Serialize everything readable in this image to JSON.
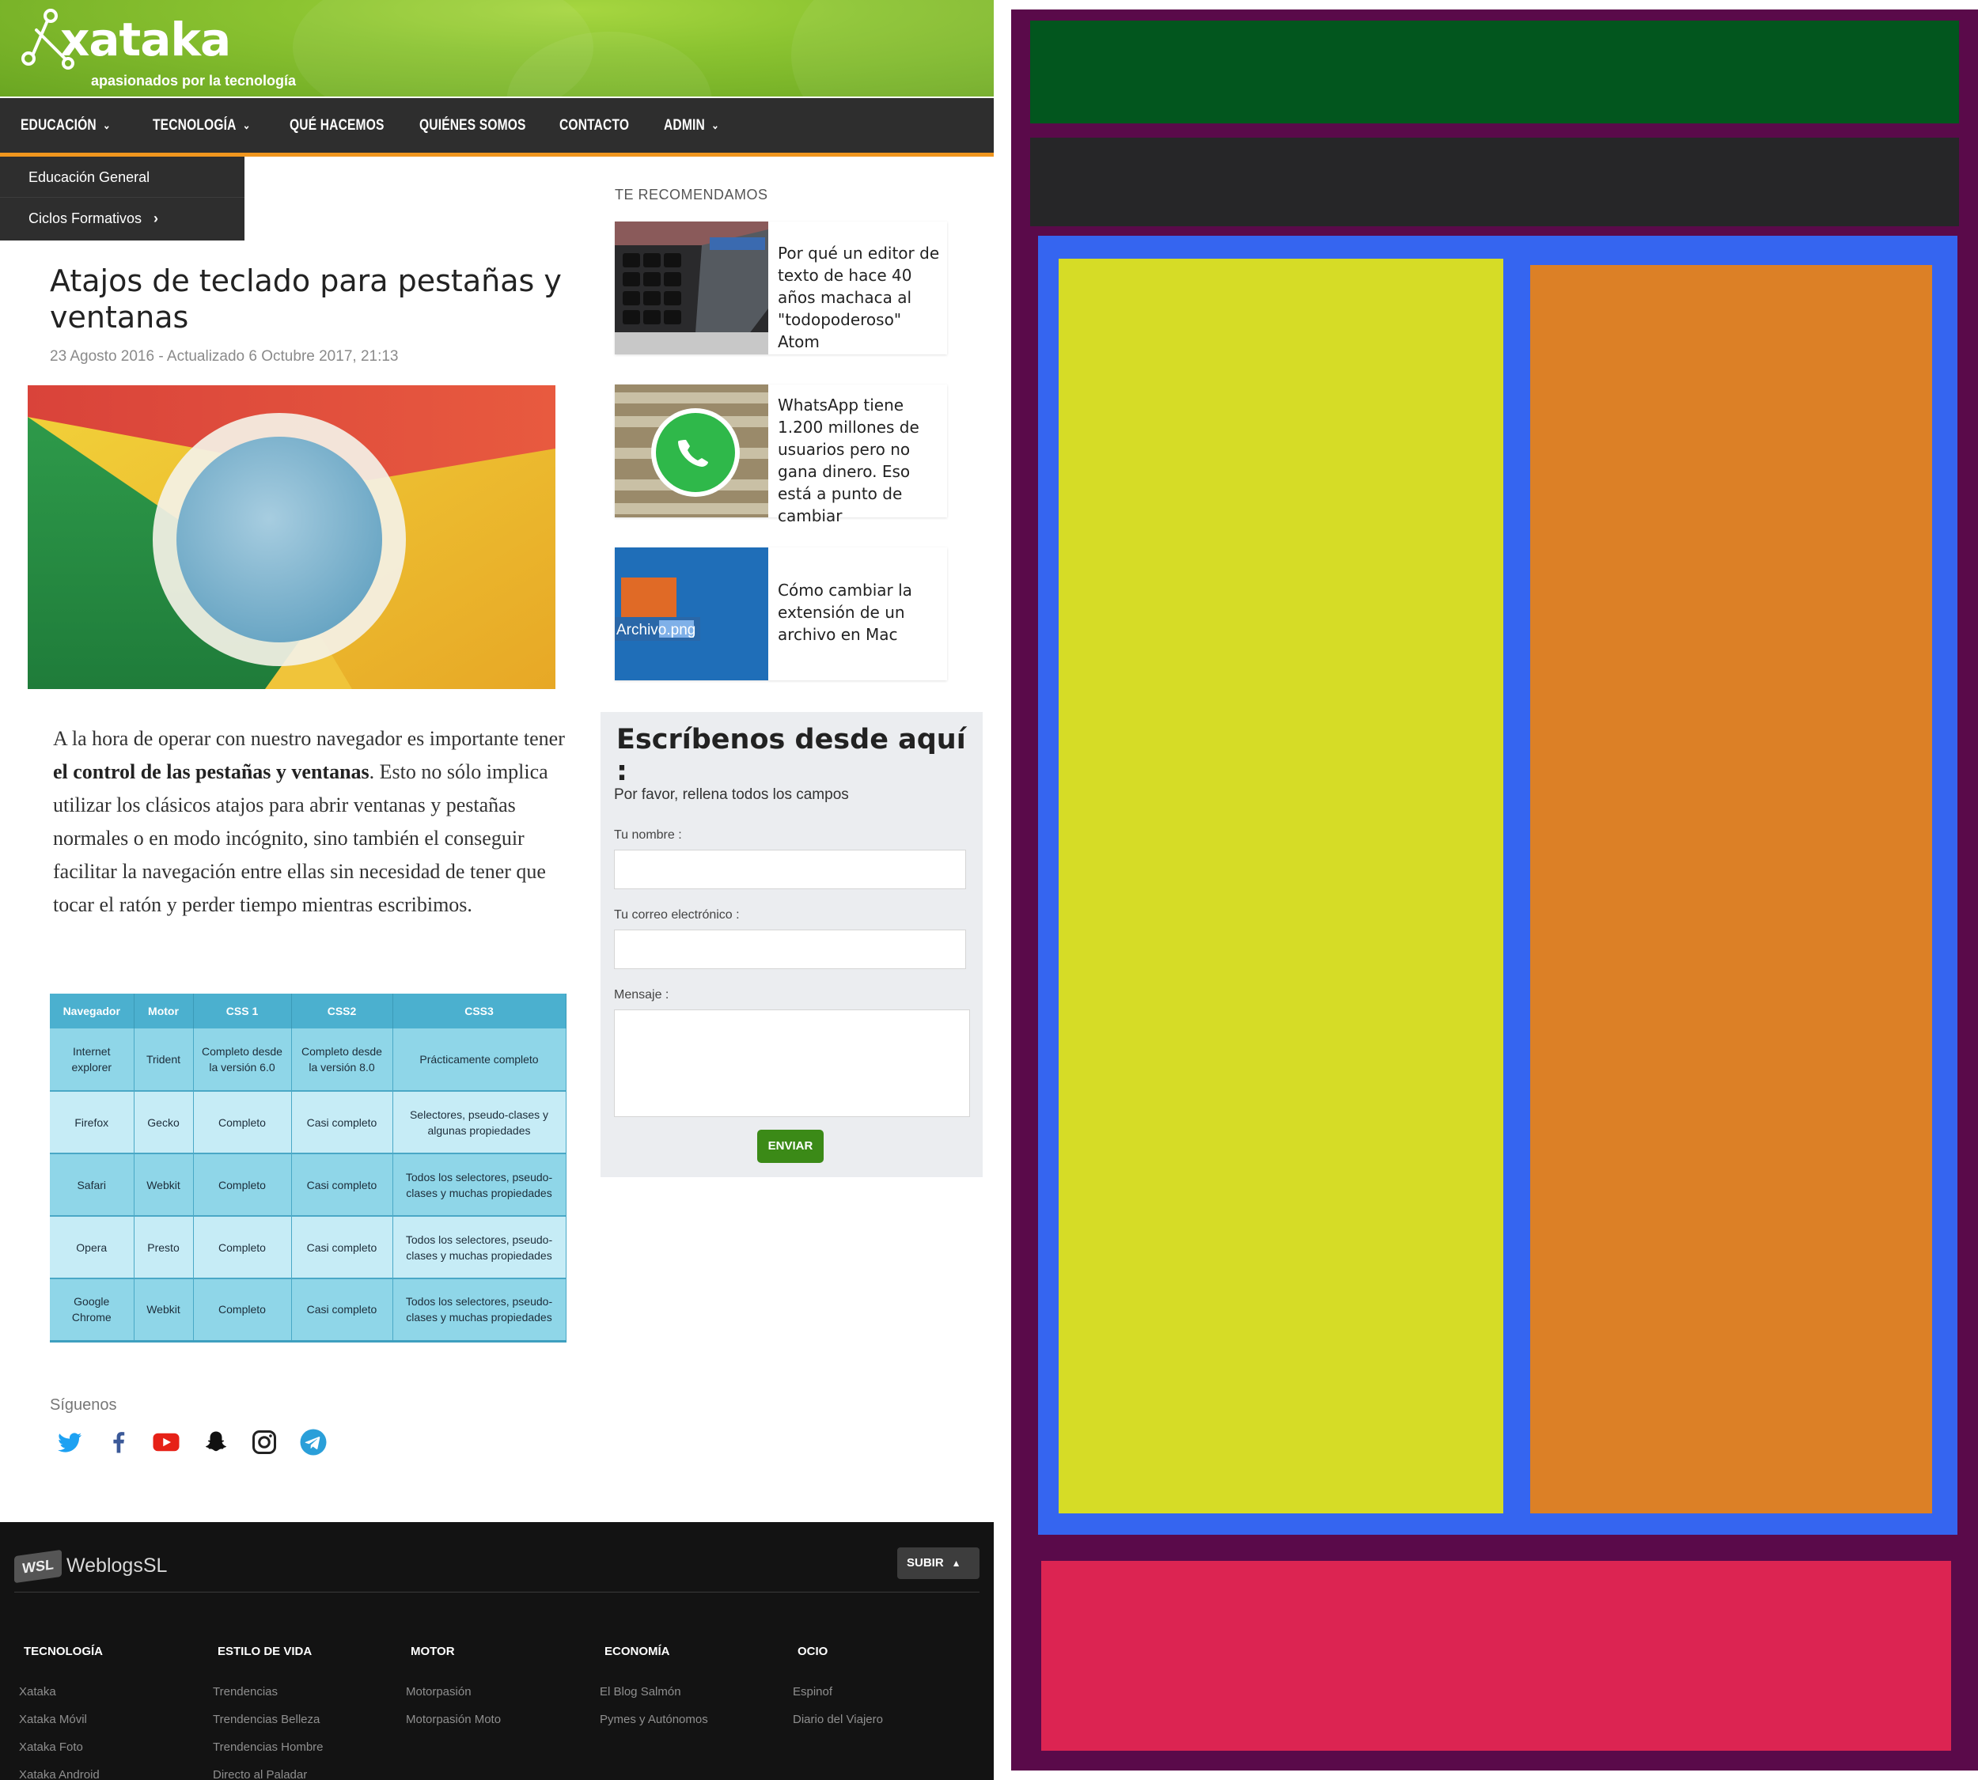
{
  "site": {
    "logo": {
      "text": "xataka",
      "tagline": "apasionados por la tecnología"
    },
    "nav": [
      {
        "label": "EDUCACIÓN",
        "has_dropdown": true
      },
      {
        "label": "TECNOLOGÍA",
        "has_dropdown": true
      },
      {
        "label": "QUÉ HACEMOS",
        "has_dropdown": false
      },
      {
        "label": "QUIÉNES SOMOS",
        "has_dropdown": false
      },
      {
        "label": "CONTACTO",
        "has_dropdown": false
      },
      {
        "label": "ADMIN",
        "has_dropdown": true
      }
    ],
    "dropdown": [
      {
        "label": "Educación General"
      },
      {
        "label": "Ciclos Formativos",
        "has_submenu": true
      }
    ],
    "article": {
      "title": "Atajos de teclado para pestañas y ventanas",
      "date": "23 Agosto 2016 - Actualizado 6 Octubre 2017, 21:13",
      "body_before": "A la hora de operar con nuestro navegador es importante tener ",
      "body_bold": "el control de las pestañas y ventanas",
      "body_after": ". Esto no sólo implica utilizar los clásicos atajos para abrir ventanas y pestañas normales o en modo incógnito, sino también el conseguir facilitar la navegación entre ellas sin necesidad de tener que tocar el ratón y perder tiempo mientras escribimos."
    },
    "table": {
      "headers": [
        "Navegador",
        "Motor",
        "CSS 1",
        "CSS2",
        "CSS3"
      ],
      "rows": [
        [
          "Internet explorer",
          "Trident",
          "Completo desde la versión 6.0",
          "Completo desde la versión 8.0",
          "Prácticamente completo"
        ],
        [
          "Firefox",
          "Gecko",
          "Completo",
          "Casi completo",
          "Selectores, pseudo-clases y algunas propiedades"
        ],
        [
          "Safari",
          "Webkit",
          "Completo",
          "Casi completo",
          "Todos los selectores, pseudo-clases y muchas propiedades"
        ],
        [
          "Opera",
          "Presto",
          "Completo",
          "Casi completo",
          "Todos los selectores, pseudo-clases y muchas propiedades"
        ],
        [
          "Google Chrome",
          "Webkit",
          "Completo",
          "Casi completo",
          "Todos los selectores, pseudo-clases y muchas propiedades"
        ]
      ]
    },
    "follow": {
      "label": "Síguenos",
      "icons": [
        "twitter-icon",
        "facebook-icon",
        "youtube-icon",
        "snapchat-icon",
        "instagram-icon",
        "telegram-icon"
      ]
    },
    "sidebar": {
      "title": "TE RECOMENDAMOS",
      "items": [
        {
          "text": "Por qué un editor de texto de hace 40 años machaca al \"todopoderoso\" Atom",
          "thumb": "keyboard-image"
        },
        {
          "text": "WhatsApp tiene 1.200 millones de usuarios pero no gana dinero. Eso está a punto de cambiar",
          "thumb": "whatsapp-image"
        },
        {
          "text": "Cómo cambiar la extensión de un archivo en Mac",
          "thumb": "file-extension-image",
          "thumb_label": "Archivo.png"
        }
      ]
    },
    "contact": {
      "title": "Escríbenos desde aquí :",
      "subtitle": "Por favor, rellena todos los campos",
      "name_label": "Tu nombre :",
      "email_label": "Tu correo electrónico :",
      "message_label": "Mensaje :",
      "send_label": "ENVIAR"
    },
    "footer": {
      "brand_mark": "WSL",
      "brand": "WeblogsSL",
      "up_label": "SUBIR",
      "columns": [
        {
          "title": "TECNOLOGÍA",
          "links": [
            "Xataka",
            "Xataka Móvil",
            "Xataka Foto",
            "Xataka Android"
          ]
        },
        {
          "title": "ESTILO DE VIDA",
          "links": [
            "Trendencias",
            "Trendencias Belleza",
            "Trendencias Hombre",
            "Directo al Paladar"
          ]
        },
        {
          "title": "MOTOR",
          "links": [
            "Motorpasión",
            "Motorpasión Moto"
          ]
        },
        {
          "title": "ECONOMÍA",
          "links": [
            "El Blog Salmón",
            "Pymes y Autónomos"
          ]
        },
        {
          "title": "OCIO",
          "links": [
            "Espinof",
            "Diario del Viajero"
          ]
        }
      ]
    }
  },
  "colors": {
    "header_green": "#8cc431",
    "nav_dark": "#2e2e2e",
    "nav_accent": "#f0961e",
    "table_header": "#4bb0cf",
    "send_button": "#3b8a17",
    "footer_bg": "#131313",
    "diagram_background": "#5a0a4a",
    "diagram_header": "#02561e",
    "diagram_nav": "#262628",
    "diagram_content": "#3565f0",
    "diagram_main": "#d6dc26",
    "diagram_sidebar": "#dc8026",
    "diagram_footer": "#dc2452"
  }
}
